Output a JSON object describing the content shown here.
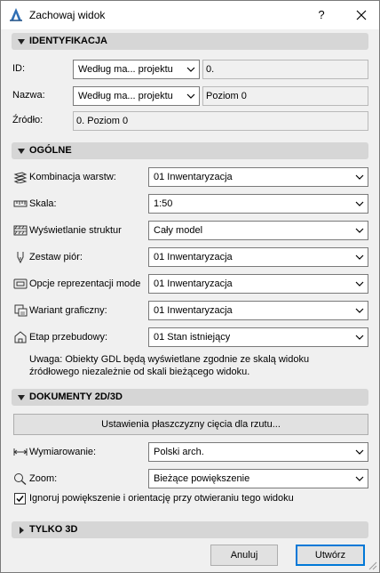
{
  "window": {
    "title": "Zachowaj widok",
    "help_label": "?"
  },
  "identyfikacja": {
    "header": "IDENTYFIKACJA",
    "id_label": "ID:",
    "id_combo": "Według ma... projektu",
    "id_value": "0.",
    "nazwa_label": "Nazwa:",
    "nazwa_combo": "Według ma... projektu",
    "nazwa_value": "Poziom 0",
    "zrodlo_label": "Źródło:",
    "zrodlo_value": "0. Poziom 0"
  },
  "ogolne": {
    "header": "OGÓLNE",
    "rows": [
      {
        "label": "Kombinacja warstw:",
        "value": "01 Inwentaryzacja",
        "icon": "layers-icon"
      },
      {
        "label": "Skala:",
        "value": "1:50",
        "icon": "ruler-icon"
      },
      {
        "label": "Wyświetlanie struktur",
        "value": "Cały model",
        "icon": "structure-icon"
      },
      {
        "label": "Zestaw piór:",
        "value": "01 Inwentaryzacja",
        "icon": "pen-icon"
      },
      {
        "label": "Opcje reprezentacji mode",
        "value": "01 Inwentaryzacja",
        "icon": "model-display-icon"
      },
      {
        "label": "Wariant graficzny:",
        "value": "01 Inwentaryzacja",
        "icon": "graphic-override-icon"
      },
      {
        "label": "Etap przebudowy:",
        "value": "01 Stan istniejący",
        "icon": "renovation-icon"
      }
    ],
    "note": "Uwaga: Obiekty GDL będą wyświetlane zgodnie ze skalą widoku źródłowego niezależnie od skali bieżącego widoku."
  },
  "dokumenty": {
    "header": "DOKUMENTY 2D/3D",
    "cut_plane_button": "Ustawienia płaszczyzny cięcia dla rzutu...",
    "wymiarowanie_label": "Wymiarowanie:",
    "wymiarowanie_value": "Polski arch.",
    "zoom_label": "Zoom:",
    "zoom_value": "Bieżące powiększenie",
    "ignore_zoom_label": "Ignoruj powiększenie i orientację przy otwieraniu tego widoku",
    "ignore_zoom_checked": true
  },
  "tylko3d": {
    "header": "TYLKO 3D"
  },
  "footer": {
    "cancel_label": "Anuluj",
    "create_label": "Utwórz"
  },
  "colors": {
    "section_bg": "#d6d6d6",
    "default_button_border": "#0078d7",
    "app_icon": "#2f6fb5"
  }
}
